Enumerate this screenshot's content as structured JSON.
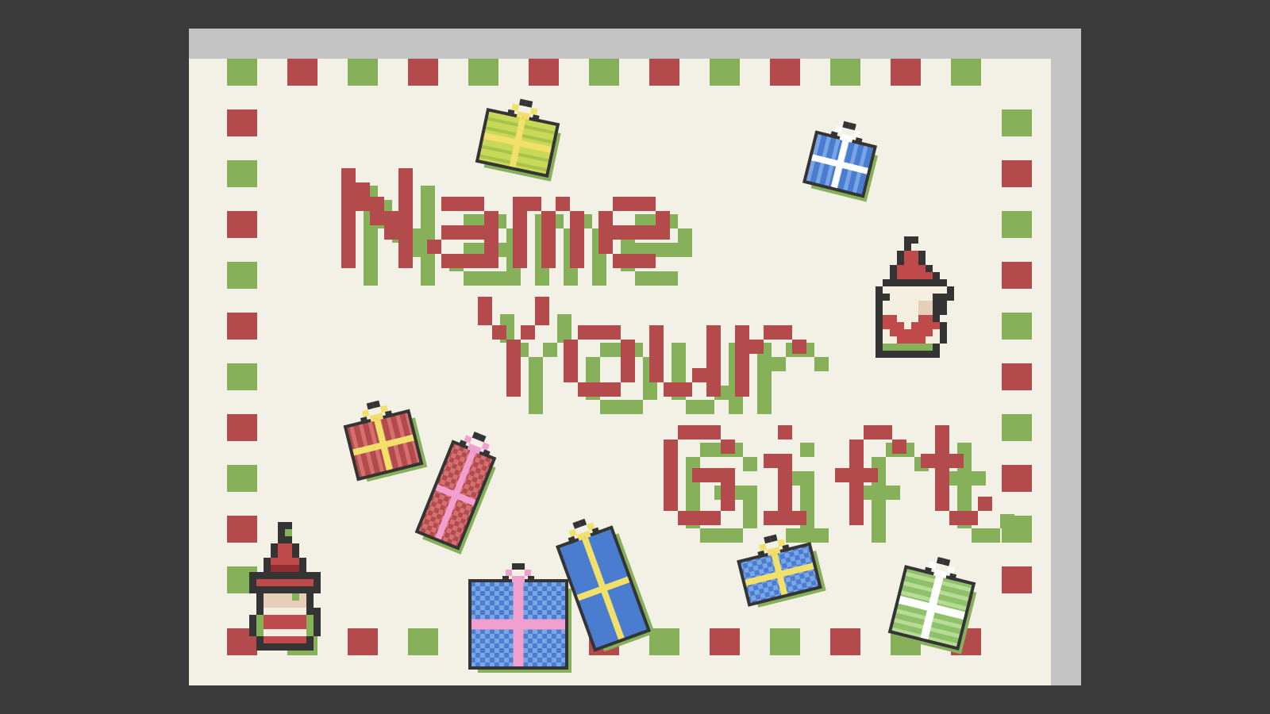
{
  "screen": "title-screen",
  "title": {
    "lines": [
      "Name",
      "Your",
      "Gift"
    ],
    "colors": {
      "main": "#b34b4c",
      "shadow": "#86b05a"
    }
  },
  "palette": {
    "background": "#3a3a3a",
    "card": "#f3f0e6",
    "card_shadow": "#c3c3c3",
    "border_green": "#86b05a",
    "border_red": "#b34b4c",
    "outline": "#343434",
    "gift_blue": "#4a7cd0",
    "gift_red": "#b34b4c",
    "gift_green": "#8fc06a",
    "ribbon_yellow": "#f1e16a",
    "ribbon_pink": "#f19fcf",
    "ribbon_white": "#ffffff"
  },
  "characters": [
    {
      "name": "elf",
      "hat_color": "red"
    },
    {
      "name": "santa-gnome",
      "hat_color": "red"
    }
  ],
  "gifts": [
    {
      "name": "gift-green-yellow",
      "box": "green",
      "ribbon": "yellow"
    },
    {
      "name": "gift-blue-white",
      "box": "blue",
      "ribbon": "white"
    },
    {
      "name": "gift-red-yellow",
      "box": "red",
      "ribbon": "yellow"
    },
    {
      "name": "gift-red-pink",
      "box": "red",
      "ribbon": "pink"
    },
    {
      "name": "gift-blue-pink-large",
      "box": "blue",
      "ribbon": "pink"
    },
    {
      "name": "gift-blue-yellow-tall",
      "box": "blue",
      "ribbon": "yellow"
    },
    {
      "name": "gift-blue-yellow-small",
      "box": "blue",
      "ribbon": "yellow"
    },
    {
      "name": "gift-green-white",
      "box": "green",
      "ribbon": "white"
    }
  ]
}
